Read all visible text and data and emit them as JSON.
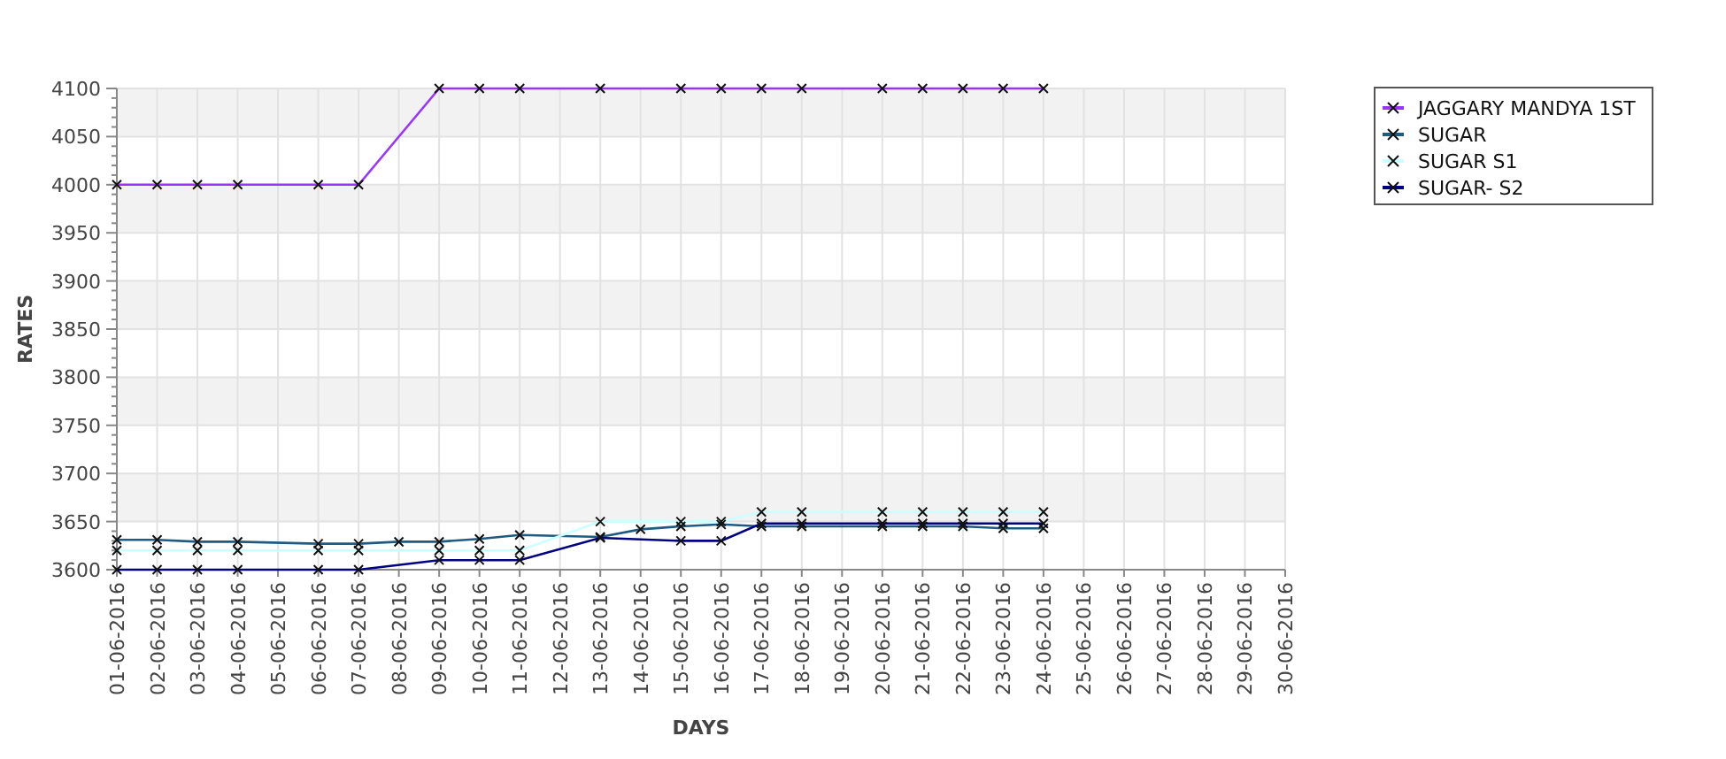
{
  "chart_data": {
    "type": "line",
    "xlabel": "DAYS",
    "ylabel": "RATES",
    "grid": true,
    "legend": true,
    "categories": [
      "01-06-2016",
      "02-06-2016",
      "03-06-2016",
      "04-06-2016",
      "05-06-2016",
      "06-06-2016",
      "07-06-2016",
      "08-06-2016",
      "09-06-2016",
      "10-06-2016",
      "11-06-2016",
      "12-06-2016",
      "13-06-2016",
      "14-06-2016",
      "15-06-2016",
      "16-06-2016",
      "17-06-2016",
      "18-06-2016",
      "19-06-2016",
      "20-06-2016",
      "21-06-2016",
      "22-06-2016",
      "23-06-2016",
      "24-06-2016",
      "25-06-2016",
      "26-06-2016",
      "27-06-2016",
      "28-06-2016",
      "29-06-2016",
      "30-06-2016"
    ],
    "ylim": [
      3600,
      4100
    ],
    "yticks": [
      3600,
      3650,
      3700,
      3750,
      3800,
      3850,
      3900,
      3950,
      4000,
      4050,
      4100
    ],
    "series": [
      {
        "name": "JAGGARY MANDYA 1ST",
        "color": "#9933ff",
        "marker": "x",
        "values": [
          4000,
          4000,
          4000,
          4000,
          null,
          4000,
          4000,
          null,
          4100,
          4100,
          4100,
          null,
          4100,
          null,
          4100,
          4100,
          4100,
          4100,
          null,
          4100,
          4100,
          4100,
          4100,
          4100,
          null,
          null,
          null,
          null,
          null,
          null
        ]
      },
      {
        "name": "SUGAR",
        "color": "#1f5a80",
        "marker": "x",
        "values": [
          3631,
          3631,
          3629,
          3629,
          null,
          3627,
          3627,
          3629,
          3629,
          3632,
          3636,
          null,
          3634,
          3642,
          3645,
          3647,
          3645,
          3645,
          null,
          3645,
          3645,
          3645,
          3643,
          3643,
          null,
          null,
          null,
          null,
          null,
          null
        ]
      },
      {
        "name": "SUGAR S1",
        "color": "#ccffff",
        "marker": "x",
        "values": [
          3620,
          3620,
          3620,
          3620,
          null,
          3620,
          3620,
          null,
          3620,
          3620,
          3620,
          null,
          3650,
          null,
          3650,
          3650,
          3660,
          3660,
          null,
          3660,
          3660,
          3660,
          3660,
          3660,
          null,
          null,
          null,
          null,
          null,
          null
        ]
      },
      {
        "name": "SUGAR- S2",
        "color": "#000080",
        "marker": "x",
        "values": [
          3600,
          3600,
          3600,
          3600,
          null,
          3600,
          3600,
          null,
          3610,
          3610,
          3610,
          null,
          3633,
          null,
          3630,
          3630,
          3648,
          3648,
          null,
          3648,
          3648,
          3648,
          3648,
          3648,
          null,
          null,
          null,
          null,
          null,
          null
        ]
      }
    ]
  }
}
